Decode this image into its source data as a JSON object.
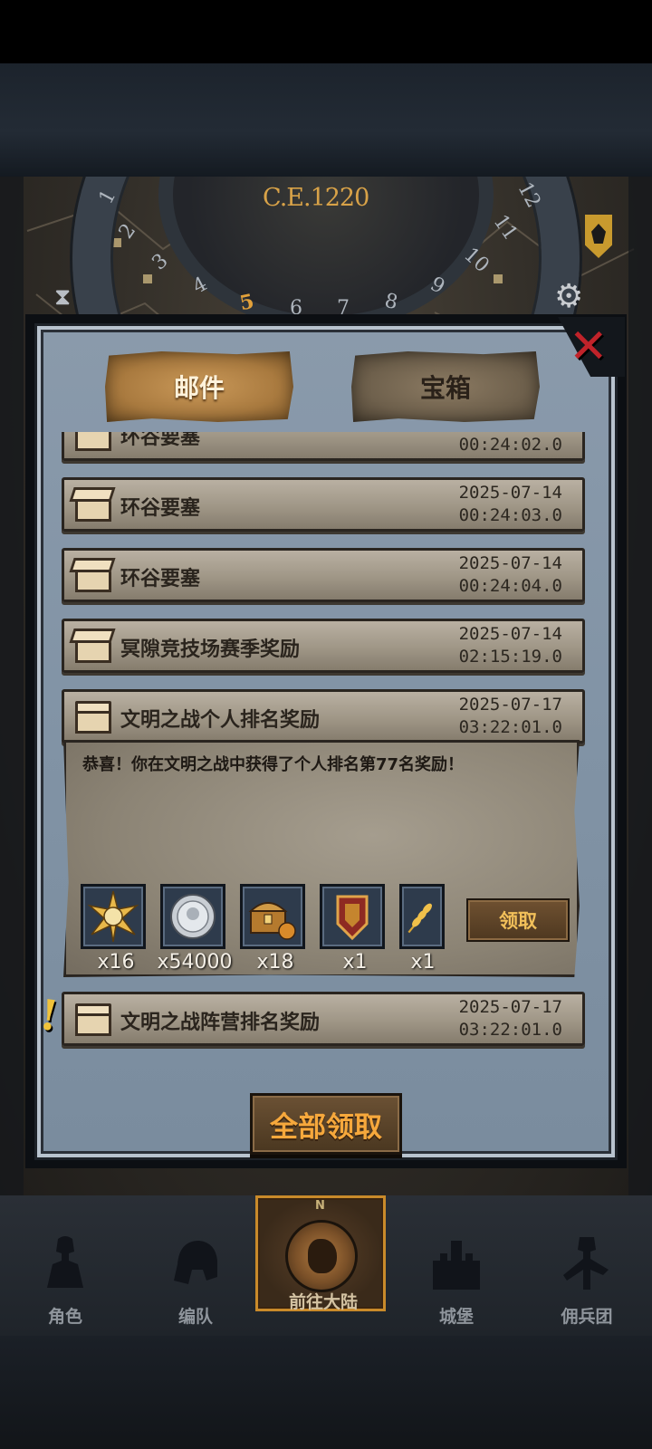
{
  "header": {
    "year": "C.E.1220",
    "dial_numbers": [
      "1",
      "2",
      "3",
      "4",
      "5",
      "6",
      "7",
      "8",
      "9",
      "10",
      "11",
      "12"
    ]
  },
  "modal": {
    "tabs": [
      {
        "label": "邮件",
        "active": true
      },
      {
        "label": "宝箱",
        "active": false
      }
    ],
    "close_icon": "close-x-icon",
    "mails": [
      {
        "title": "环谷要塞",
        "date": "",
        "time": "00:24:02.0",
        "opened": true
      },
      {
        "title": "环谷要塞",
        "date": "2025-07-14",
        "time": "00:24:03.0",
        "opened": true
      },
      {
        "title": "环谷要塞",
        "date": "2025-07-14",
        "time": "00:24:04.0",
        "opened": true
      },
      {
        "title": "冥隙竞技场赛季奖励",
        "date": "2025-07-14",
        "time": "02:15:19.0",
        "opened": true
      },
      {
        "title": "文明之战个人排名奖励",
        "date": "2025-07-17",
        "time": "03:22:01.0",
        "opened": false
      },
      {
        "title": "文明之战阵营排名奖励",
        "date": "2025-07-17",
        "time": "03:22:01.0",
        "opened": false
      }
    ],
    "detail": {
      "message": "恭喜！你在文明之战中获得了个人排名第77名奖励！",
      "rewards": [
        {
          "icon": "sun-medal-icon",
          "qty": "x16"
        },
        {
          "icon": "silver-coin-icon",
          "qty": "x54000"
        },
        {
          "icon": "treasure-chest-icon",
          "qty": "x18"
        },
        {
          "icon": "crest-badge-icon",
          "qty": "x1"
        },
        {
          "icon": "wheat-icon",
          "qty": "x1"
        }
      ],
      "claim_label": "领取"
    },
    "claim_all_label": "全部领取"
  },
  "nav": [
    {
      "label": "角色",
      "icon": "knight-icon",
      "active": false
    },
    {
      "label": "编队",
      "icon": "helmet-icon",
      "active": false
    },
    {
      "label": "前往大陆",
      "icon": "compass-icon",
      "active": true
    },
    {
      "label": "城堡",
      "icon": "castle-icon",
      "active": false
    },
    {
      "label": "佣兵团",
      "icon": "mercenary-icon",
      "active": false
    }
  ],
  "colors": {
    "accent_gold": "#f6a83c",
    "close_red": "#c0232a",
    "panel_blue": "#8193a5"
  }
}
